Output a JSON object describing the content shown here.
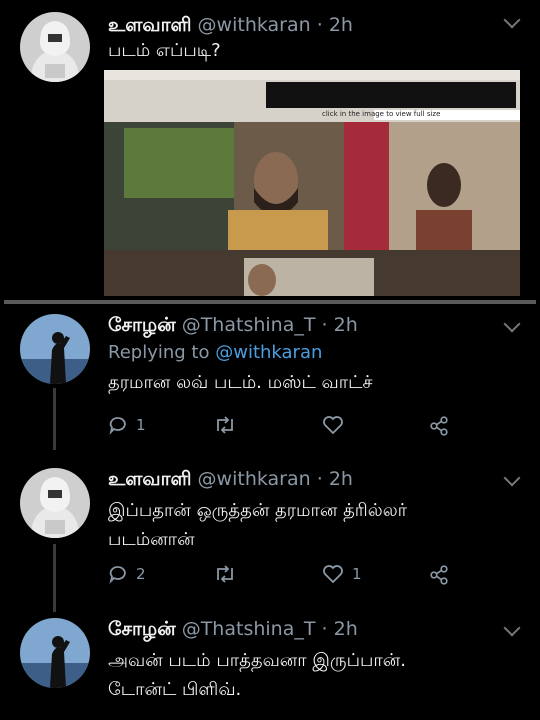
{
  "tweets": [
    {
      "name": "உளவாளி",
      "handle": "@withkaran",
      "time": "2h",
      "body": [
        "படம் எப்படி?"
      ],
      "media": {
        "top_text": "click in the image to view full size"
      }
    },
    {
      "name": "சோழன்",
      "handle": "@Thatshina_T",
      "time": "2h",
      "replying_prefix": "Replying to",
      "replying_to": "@withkaran",
      "body": [
        "தரமான லவ் படம். மஸ்ட் வாட்ச்"
      ],
      "actions": {
        "reply_count": "1",
        "retweet_count": "",
        "like_count": ""
      }
    },
    {
      "name": "உளவாளி",
      "handle": "@withkaran",
      "time": "2h",
      "body": [
        "இப்பதான் ஒருத்தன் தரமான த்ரில்லர்",
        "படம்னான்"
      ],
      "actions": {
        "reply_count": "2",
        "retweet_count": "",
        "like_count": "1"
      }
    },
    {
      "name": "சோழன்",
      "handle": "@Thatshina_T",
      "time": "2h",
      "body": [
        "அவன் படம் பாத்தவனா இருப்பான்.",
        "டோன்ட் பிளிவ்."
      ]
    }
  ],
  "icons": {
    "reply": "reply-icon",
    "retweet": "retweet-icon",
    "like": "heart-icon",
    "share": "share-icon",
    "more": "chevron-down-icon"
  },
  "colors": {
    "background": "#000000",
    "handle": "#8b98a5",
    "link": "#4a9fe0"
  }
}
